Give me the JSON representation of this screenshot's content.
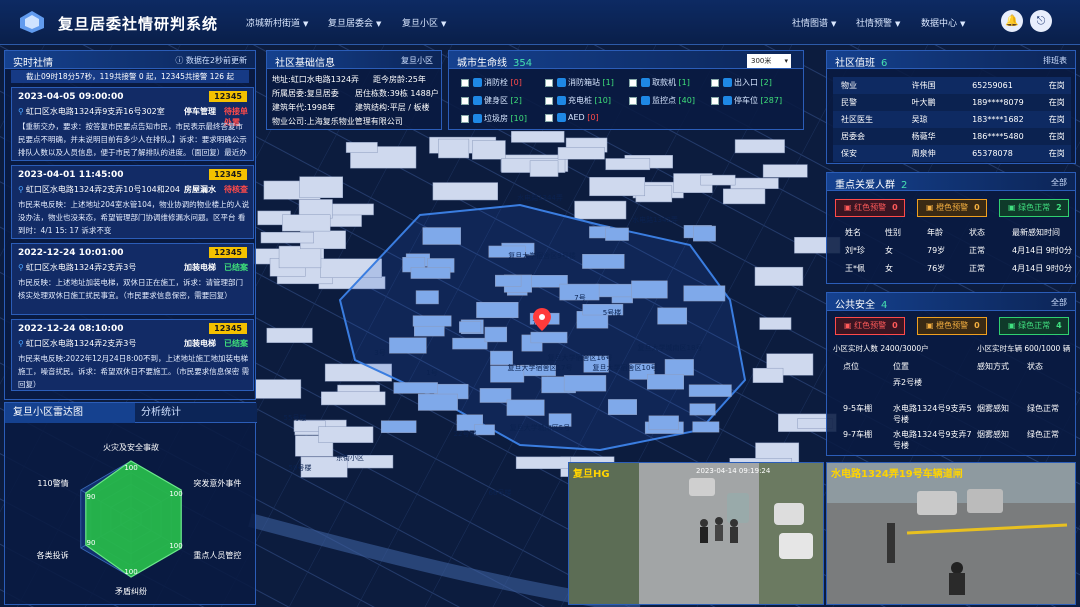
{
  "app": {
    "title": "复旦居委社情研判系统"
  },
  "nav": {
    "left": [
      "凉城新村街道",
      "复旦居委会",
      "复旦小区"
    ],
    "right": [
      "社情图谱",
      "社情预警",
      "数据中心"
    ]
  },
  "realtime": {
    "title": "实时社情",
    "update_note": "数据在2秒前更新",
    "summary": "截止09时18分57秒，119共接警 0 起，12345共接警 126 起",
    "cards": [
      {
        "datetime": "2023-04-05 09:00:00",
        "badge": "12345",
        "address": "虹口区水电路1324弄9支弄16号302室",
        "category": "停车管理",
        "status": "待接单处置",
        "status_color": "red",
        "body": "【重新交办，要求：按答复市民要点告知市民，市民表示最终答复市民要点不明确，并未说明目前有多少人在排队。】诉求：要求明确公示排队人数以及人员信息，便于市民了解排队的进度。（面回复）最近办结"
      },
      {
        "datetime": "2023-04-01 11:45:00",
        "badge": "12345",
        "address": "虹口区水电路1324弄2支弄10号104和204",
        "category": "房屋漏水",
        "status": "待核查",
        "status_color": "red",
        "body": "市民来电反映：上述地址204室水管104，物业协调的物业楼上的人说没办法，物业也没来态，希望管理部门协调维修漏水问题。区平台 看到时：4/1 15: 17 诉求不变"
      },
      {
        "datetime": "2022-12-24 10:01:00",
        "badge": "12345",
        "address": "虹口区水电路1324弄2支弄3号",
        "category": "加装电梯",
        "status": "已结案",
        "status_color": "green",
        "body": "市民反映：上述地址加装电梯，双休日正在施工，诉求：请管理部门核实处理双休日施工扰民事宜。（市民要求信息保密，需要回复）"
      },
      {
        "datetime": "2022-12-24 08:10:00",
        "badge": "12345",
        "address": "虹口区水电路1324弄2支弄3号",
        "category": "加装电梯",
        "status": "已结案",
        "status_color": "green",
        "body": "市民来电反映:2022年12月24日8:00不到，上述地址施工地加装电梯施工，噪音扰民。诉求：希望双休日不要施工。（市民要求信息保密 需回复）"
      }
    ]
  },
  "radar": {
    "tab_active": "复旦小区雷达图",
    "tab_other": "分析统计",
    "axes": [
      "火灾及安全事故",
      "突发意外事件",
      "重点人员管控",
      "矛盾纠纷",
      "各类投诉",
      "110警情"
    ],
    "values": [
      100,
      100,
      100,
      100,
      90,
      90
    ],
    "max": 100
  },
  "basic": {
    "title": "社区基础信息",
    "scope": "复旦小区",
    "address_label": "地址:",
    "address": "虹口水电路1324弄",
    "distance_label": "距今房龄:",
    "distance": "25年",
    "committee_label": "所属居委:",
    "committee": "复旦居委",
    "total_label": "居住栋数:",
    "total": "39栋 1488户",
    "year_label": "建筑年代:",
    "year": "1998年",
    "style_label": "建筑结构:",
    "style": "平层 / 板楼",
    "company_label": "物业公司:",
    "company": "上海复乐物业管理有限公司"
  },
  "lifeline": {
    "title": "城市生命线",
    "count": "354",
    "range": "300米",
    "items": [
      {
        "label": "消防栓",
        "value": "[0]",
        "color": "red"
      },
      {
        "label": "消防箱站",
        "value": "[1]",
        "color": "green"
      },
      {
        "label": "取款机",
        "value": "[1]",
        "color": "green"
      },
      {
        "label": "出入口",
        "value": "[2]",
        "color": "green"
      },
      {
        "label": "健身区",
        "value": "[2]",
        "color": "green"
      },
      {
        "label": "充电桩",
        "value": "[10]",
        "color": "green"
      },
      {
        "label": "监控点",
        "value": "[40]",
        "color": "green"
      },
      {
        "label": "停车位",
        "value": "[287]",
        "color": "green"
      },
      {
        "label": "垃圾房",
        "value": "[10]",
        "color": "green"
      },
      {
        "label": "AED",
        "value": "[0]",
        "color": "red"
      }
    ]
  },
  "duty": {
    "title": "社区值班",
    "count": "6",
    "link": "排班表",
    "rows": [
      {
        "role": "物业",
        "name": "许伟国",
        "phone": "65259061",
        "status": "在岗"
      },
      {
        "role": "民警",
        "name": "叶大鹏",
        "phone": "189****8079",
        "status": "在岗"
      },
      {
        "role": "社区医生",
        "name": "吴琼",
        "phone": "183****1682",
        "status": "在岗"
      },
      {
        "role": "居委会",
        "name": "杨薇华",
        "phone": "186****5480",
        "status": "在岗"
      },
      {
        "role": "保安",
        "name": "周泉伸",
        "phone": "65378078",
        "status": "在岗"
      }
    ]
  },
  "care": {
    "title": "重点关爱人群",
    "count": "2",
    "link": "全部",
    "red_label": "红色预警",
    "red": "0",
    "orange_label": "橙色预警",
    "orange": "0",
    "green_label": "绿色正常",
    "green": "2",
    "headers": [
      "姓名",
      "性别",
      "年龄",
      "状态",
      "最新感知时间"
    ],
    "rows": [
      {
        "name": "刘*珍",
        "sex": "女",
        "age": "79岁",
        "status": "正常",
        "time": "4月14日 9时0分"
      },
      {
        "name": "王*佩",
        "sex": "女",
        "age": "76岁",
        "status": "正常",
        "time": "4月14日 9时0分"
      }
    ]
  },
  "safety": {
    "title": "公共安全",
    "count": "4",
    "link": "全部",
    "red_label": "红色预警",
    "red": "0",
    "orange_label": "橙色预警",
    "orange": "0",
    "green_label": "绿色正常",
    "green": "4",
    "people": "小区实时人数 2400/3000户",
    "cars": "小区实时车辆 600/1000 辆",
    "headers": [
      "点位",
      "位置",
      "感知方式",
      "状态"
    ],
    "rows": [
      {
        "point": "",
        "loc": "弄2号楼",
        "mode": "",
        "status": ""
      },
      {
        "point": "9-5车棚",
        "loc": "水电路1324号9支弄5号楼",
        "mode": "烟雾感知",
        "status": "绿色正常"
      },
      {
        "point": "9-7车棚",
        "loc": "水电路1324号9支弄7号楼",
        "mode": "烟雾感知",
        "status": "绿色正常"
      }
    ]
  },
  "cameras": [
    {
      "title": "复旦HG",
      "time": "2023-04-14 09:19:24"
    },
    {
      "title": "水电路1324弄19号车辆道闸",
      "time": ""
    }
  ],
  "map": {
    "labels": [
      "复旦大学宿舍区9号楼",
      "复旦大学宿舍区16号",
      "复旦大学宿舍区17号",
      "复旦大学城南区5号",
      "复旦大学宿舍区10号",
      "复旦大学城南区18号",
      "水电路1344弄",
      "水电路1342弄",
      "东街小区",
      "22号楼",
      "55号楼",
      "59号楼",
      "66号楼",
      "1号",
      "7号",
      "5号楼",
      "3号",
      "7号"
    ],
    "colors": {
      "bg": "#0a1733",
      "building": "#cfd9ee",
      "community": "#7fa9ea",
      "boundary": "#3a7de0"
    }
  }
}
